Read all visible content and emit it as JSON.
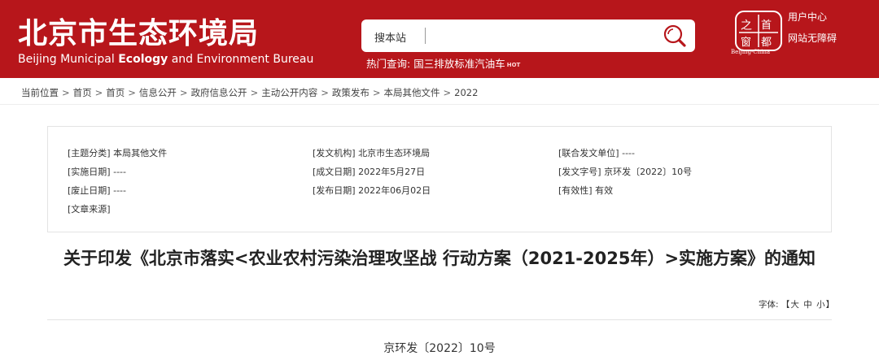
{
  "header": {
    "site_title_cn": "北京市生态环境局",
    "site_title_en_part1": "Beijing Municipal ",
    "site_title_en_bold": "Ecology",
    "site_title_en_part2": " and Environment Bureau",
    "search": {
      "label": "搜本站",
      "value": "",
      "placeholder": ""
    },
    "hot_query_label": "热门查询:",
    "hot_query_link": "国三排放标准汽油车",
    "hot_tag": "HOT",
    "emblem_text": "Beijing-China",
    "user_center": "用户中心",
    "accessibility": "网站无障碍"
  },
  "breadcrumb": {
    "prefix": "当前位置",
    "items": [
      "首页",
      "首页",
      "信息公开",
      "政府信息公开",
      "主动公开内容",
      "政策发布",
      "本局其他文件",
      "2022"
    ],
    "separator": ">"
  },
  "meta": {
    "topic": {
      "key": "[主题分类]",
      "value": "本局其他文件"
    },
    "issuer": {
      "key": "[发文机构]",
      "value": "北京市生态环境局"
    },
    "joint_issuer": {
      "key": "[联合发文单位]",
      "value": "----"
    },
    "effective_date": {
      "key": "[实施日期]",
      "value": "----"
    },
    "written_date": {
      "key": "[成文日期]",
      "value": "2022年5月27日"
    },
    "doc_no": {
      "key": "[发文字号]",
      "value": "京环发〔2022〕10号"
    },
    "abolish_date": {
      "key": "[废止日期]",
      "value": "----"
    },
    "publish_date": {
      "key": "[发布日期]",
      "value": "2022年06月02日"
    },
    "validity": {
      "key": "[有效性]",
      "value": "有效"
    },
    "source": {
      "key": "[文章来源]",
      "value": ""
    }
  },
  "document": {
    "title": "关于印发《北京市落实<农业农村污染治理攻坚战 行动方案（2021-2025年）>实施方案》的通知",
    "font_size_label": "字体:",
    "font_size_open": "【",
    "font_size_large": "大",
    "font_size_medium": "中",
    "font_size_small": "小",
    "font_size_close": "】",
    "doc_number": "京环发〔2022〕10号"
  },
  "colors": {
    "brand_red": "#b7161b"
  },
  "icons": {
    "search": "search-icon",
    "emblem": "beijing-emblem-icon"
  }
}
